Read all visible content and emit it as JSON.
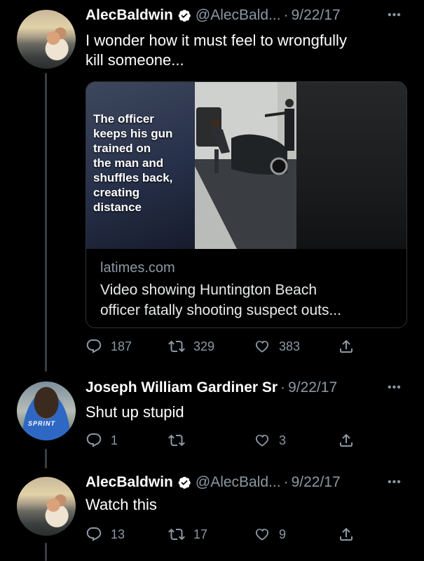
{
  "tweets": [
    {
      "name": "AlecBaldwin",
      "handle": "@AlecBald...",
      "separator": "·",
      "date": "9/22/17",
      "text_lines": [
        "I wonder how it must feel to wrongfully",
        "kill someone..."
      ],
      "verified": true,
      "card": {
        "overlay_text": [
          "The officer",
          "keeps his gun",
          "trained on",
          "the man and",
          "shuffles back,",
          "creating",
          "distance"
        ],
        "domain": "latimes.com",
        "title_lines": [
          "Video showing Huntington Beach",
          "officer fatally shooting suspect outs..."
        ]
      },
      "stats": {
        "replies": "187",
        "retweets": "329",
        "likes": "383"
      }
    },
    {
      "name": "Joseph William Gardiner Sr",
      "handle": "",
      "separator": "·",
      "date": "9/22/17",
      "text_lines": [
        "Shut up stupid"
      ],
      "verified": false,
      "avatar_text": "SPRINT",
      "stats": {
        "replies": "1",
        "retweets": "",
        "likes": "3"
      }
    },
    {
      "name": "AlecBaldwin",
      "handle": "@AlecBald...",
      "separator": "·",
      "date": "9/22/17",
      "text_lines": [
        "Watch this"
      ],
      "verified": true,
      "stats": {
        "replies": "13",
        "retweets": "17",
        "likes": "9"
      }
    }
  ],
  "more_label": "•••",
  "icons": {
    "reply": "reply-icon",
    "retweet": "retweet-icon",
    "like": "heart-icon",
    "share": "share-icon",
    "verified": "verified-badge-icon"
  },
  "colors": {
    "background": "#000000",
    "text": "#ffffff",
    "muted": "#8b98a5",
    "verified_badge": "#ffffff"
  }
}
